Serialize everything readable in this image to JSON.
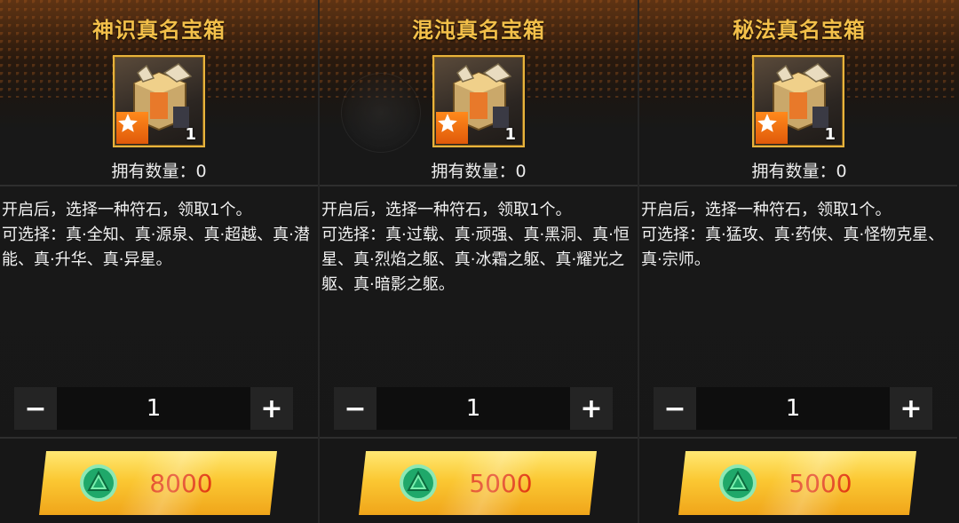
{
  "panels": [
    {
      "title": "神识真名宝箱",
      "owned_label": "拥有数量：",
      "owned_count": "0",
      "item_stack": "1",
      "desc_line1": "开启后，选择一种符石，领取1个。",
      "desc_line2": "可选择：真·全知、真·源泉、真·超越、真·潜能、真·升华、真·异星。",
      "minus_label": "−",
      "quantity": "1",
      "plus_label": "+",
      "price": "8000"
    },
    {
      "title": "混沌真名宝箱",
      "owned_label": "拥有数量：",
      "owned_count": "0",
      "item_stack": "1",
      "desc_line1": "开启后，选择一种符石，领取1个。",
      "desc_line2": "可选择：真·过载、真·顽强、真·黑洞、真·恒星、真·烈焰之躯、真·冰霜之躯、真·耀光之躯、真·暗影之躯。",
      "minus_label": "−",
      "quantity": "1",
      "plus_label": "+",
      "price": "5000"
    },
    {
      "title": "秘法真名宝箱",
      "owned_label": "拥有数量：",
      "owned_count": "0",
      "item_stack": "1",
      "desc_line1": "开启后，选择一种符石，领取1个。",
      "desc_line2": "可选择：真·猛攻、真·药侠、真·怪物克星、真·宗师。",
      "minus_label": "−",
      "quantity": "1",
      "plus_label": "+",
      "price": "5000"
    }
  ],
  "colors": {
    "title": "#f3c04a",
    "price": "#e23a12",
    "button": "#fbc833",
    "gem": "#1fa86a"
  },
  "icons": {
    "chest": "treasure-chest-icon",
    "star": "star-icon",
    "currency": "green-gem-icon"
  }
}
